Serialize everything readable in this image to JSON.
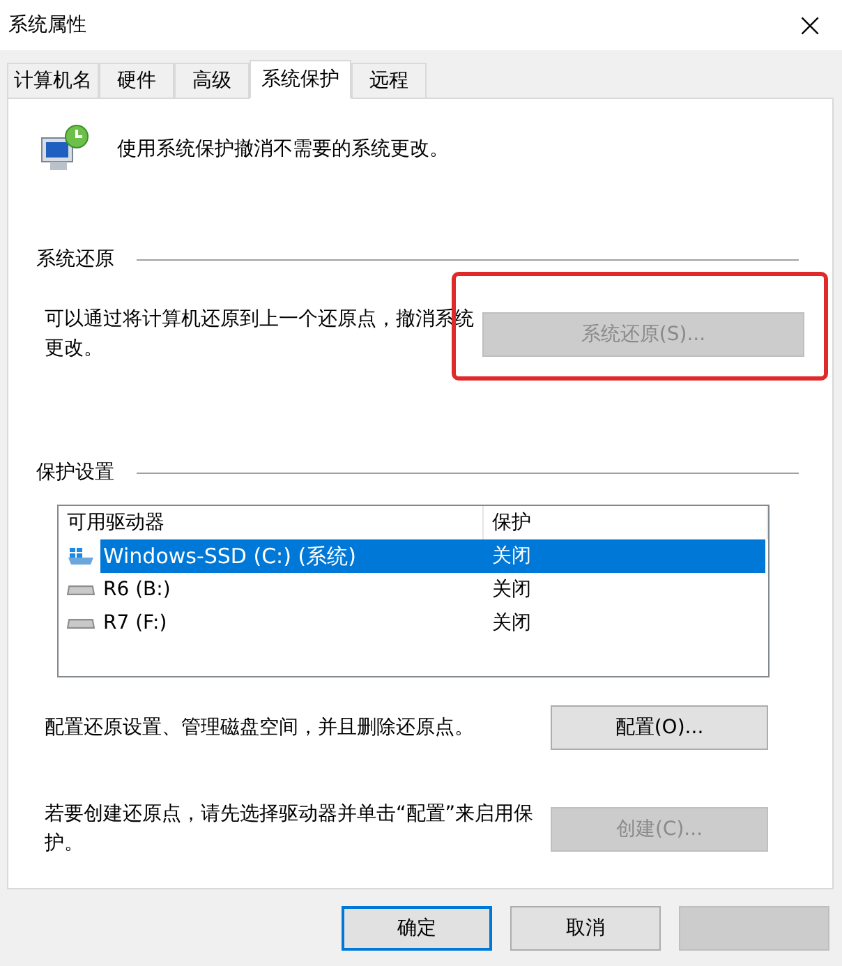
{
  "window": {
    "title": "系统属性",
    "close": "×"
  },
  "tabs": [
    {
      "label": "计算机名",
      "selected": false
    },
    {
      "label": "硬件",
      "selected": false
    },
    {
      "label": "高级",
      "selected": false
    },
    {
      "label": "系统保护",
      "selected": true
    },
    {
      "label": "远程",
      "selected": false
    }
  ],
  "intro": "使用系统保护撤消不需要的系统更改。",
  "restore": {
    "heading": "系统还原",
    "text": "可以通过将计算机还原到上一个还原点，撤消系统更改。",
    "button": {
      "label": "系统还原(S)...",
      "disabled": true
    },
    "annotation": {
      "kind": "rectangle"
    }
  },
  "protection": {
    "heading": "保护设置",
    "columns": [
      "可用驱动器",
      "保护"
    ],
    "rows": [
      {
        "drive": "Windows-SSD (C:) (系统)",
        "protection": "关闭",
        "kind": "system",
        "selected": true
      },
      {
        "drive": "R6 (B:)",
        "protection": "关闭",
        "kind": "disk",
        "selected": false
      },
      {
        "drive": "R7 (F:)",
        "protection": "关闭",
        "kind": "disk",
        "selected": false
      }
    ],
    "configure_text": "配置还原设置、管理磁盘空间，并且删除还原点。",
    "configure_button": {
      "label": "配置(O)...",
      "disabled": false
    },
    "create_text": "若要创建还原点，请先选择驱动器并单击“配置”来启用保护。",
    "create_button": {
      "label": "创建(C)...",
      "disabled": true
    }
  },
  "buttons": [
    {
      "label": "确定",
      "default": true,
      "disabled": false
    },
    {
      "label": "取消",
      "default": false,
      "disabled": false
    },
    {
      "default": false,
      "disabled": true
    }
  ]
}
